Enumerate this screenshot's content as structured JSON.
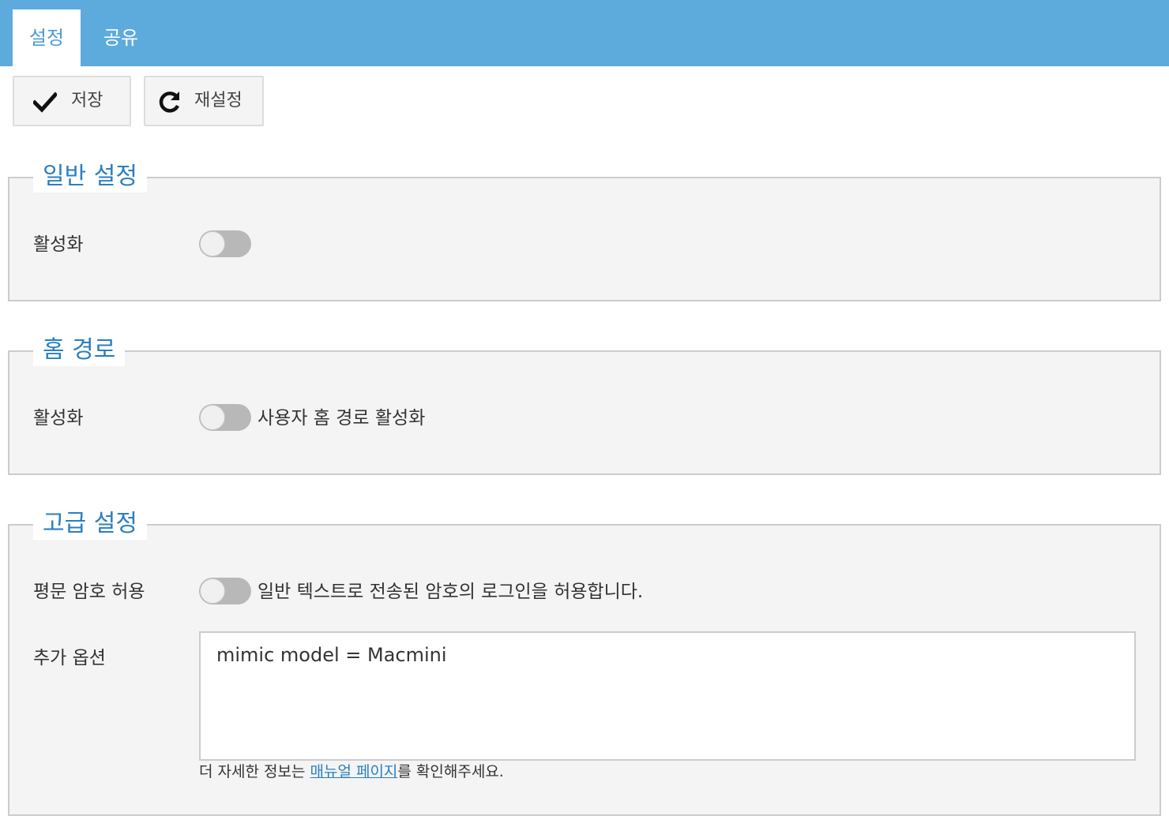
{
  "tabs": [
    {
      "label": "설정",
      "active": true
    },
    {
      "label": "공유",
      "active": false
    }
  ],
  "toolbar": {
    "save_label": "저장",
    "save_icon": "check-icon",
    "reset_label": "재설정",
    "reset_icon": "refresh-icon"
  },
  "sections": {
    "general": {
      "title": "일반 설정",
      "enable_label": "활성화",
      "enable_on": false
    },
    "home": {
      "title": "홈 경로",
      "enable_label": "활성화",
      "enable_desc": "사용자 홈 경로 활성화",
      "enable_on": false
    },
    "advanced": {
      "title": "고급 설정",
      "plaintext_label": "평문 암호 허용",
      "plaintext_desc": "일반 텍스트로 전송된 암호의 로그인을 허용합니다.",
      "plaintext_on": false,
      "options_label": "추가 옵션",
      "options_value": "mimic model = Macmini",
      "help_prefix": "더 자세한 정보는 ",
      "help_link": "매뉴얼 페이지",
      "help_suffix": "를 확인해주세요."
    }
  },
  "colors": {
    "tabbar": "#5dabdc",
    "accent": "#2b7fc0",
    "panel_bg": "#f4f4f4",
    "toggle_off": "#b8b8b8"
  }
}
